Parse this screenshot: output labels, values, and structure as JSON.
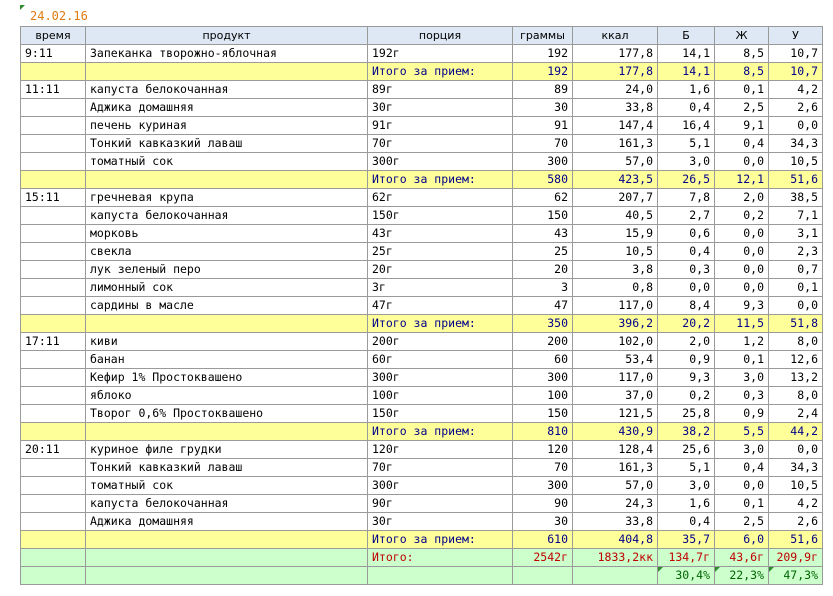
{
  "date": "24.02.16",
  "columns": [
    "время",
    "продукт",
    "порция",
    "граммы",
    "ккал",
    "Б",
    "Ж",
    "У"
  ],
  "meals": [
    {
      "time": "9:11",
      "items": [
        [
          "Запеканка творожно-яблочная",
          "192г",
          "192",
          "177,8",
          "14,1",
          "8,5",
          "10,7"
        ]
      ],
      "subtotal": [
        "Итого за прием:",
        "192",
        "177,8",
        "14,1",
        "8,5",
        "10,7"
      ]
    },
    {
      "time": "11:11",
      "items": [
        [
          "капуста белокочанная",
          "89г",
          "89",
          "24,0",
          "1,6",
          "0,1",
          "4,2"
        ],
        [
          "Аджика домашняя",
          "30г",
          "30",
          "33,8",
          "0,4",
          "2,5",
          "2,6"
        ],
        [
          "печень куриная",
          "91г",
          "91",
          "147,4",
          "16,4",
          "9,1",
          "0,0"
        ],
        [
          "Тонкий кавказкий лаваш",
          "70г",
          "70",
          "161,3",
          "5,1",
          "0,4",
          "34,3"
        ],
        [
          "томатный сок",
          "300г",
          "300",
          "57,0",
          "3,0",
          "0,0",
          "10,5"
        ]
      ],
      "subtotal": [
        "Итого за прием:",
        "580",
        "423,5",
        "26,5",
        "12,1",
        "51,6"
      ]
    },
    {
      "time": "15:11",
      "items": [
        [
          "гречневая крупа",
          "62г",
          "62",
          "207,7",
          "7,8",
          "2,0",
          "38,5"
        ],
        [
          "капуста белокочанная",
          "150г",
          "150",
          "40,5",
          "2,7",
          "0,2",
          "7,1"
        ],
        [
          "морковь",
          "43г",
          "43",
          "15,9",
          "0,6",
          "0,0",
          "3,1"
        ],
        [
          "свекла",
          "25г",
          "25",
          "10,5",
          "0,4",
          "0,0",
          "2,3"
        ],
        [
          "лук зеленый перо",
          "20г",
          "20",
          "3,8",
          "0,3",
          "0,0",
          "0,7"
        ],
        [
          "лимонный сок",
          "3г",
          "3",
          "0,8",
          "0,0",
          "0,0",
          "0,1"
        ],
        [
          "сардины в масле",
          "47г",
          "47",
          "117,0",
          "8,4",
          "9,3",
          "0,0"
        ]
      ],
      "subtotal": [
        "Итого за прием:",
        "350",
        "396,2",
        "20,2",
        "11,5",
        "51,8"
      ]
    },
    {
      "time": "17:11",
      "items": [
        [
          "киви",
          "200г",
          "200",
          "102,0",
          "2,0",
          "1,2",
          "8,0"
        ],
        [
          "банан",
          "60г",
          "60",
          "53,4",
          "0,9",
          "0,1",
          "12,6"
        ],
        [
          "Кефир 1% Простоквашено",
          "300г",
          "300",
          "117,0",
          "9,3",
          "3,0",
          "13,2"
        ],
        [
          "яблоко",
          "100г",
          "100",
          "37,0",
          "0,2",
          "0,3",
          "8,0"
        ],
        [
          "Творог 0,6% Простоквашено",
          "150г",
          "150",
          "121,5",
          "25,8",
          "0,9",
          "2,4"
        ]
      ],
      "subtotal": [
        "Итого за прием:",
        "810",
        "430,9",
        "38,2",
        "5,5",
        "44,2"
      ]
    },
    {
      "time": "20:11",
      "items": [
        [
          "куриное филе грудки",
          "120г",
          "120",
          "128,4",
          "25,6",
          "3,0",
          "0,0"
        ],
        [
          "Тонкий кавказкий лаваш",
          "70г",
          "70",
          "161,3",
          "5,1",
          "0,4",
          "34,3"
        ],
        [
          "томатный сок",
          "300г",
          "300",
          "57,0",
          "3,0",
          "0,0",
          "10,5"
        ],
        [
          "капуста белокочанная",
          "90г",
          "90",
          "24,3",
          "1,6",
          "0,1",
          "4,2"
        ],
        [
          "Аджика домашняя",
          "30г",
          "30",
          "33,8",
          "0,4",
          "2,5",
          "2,6"
        ]
      ],
      "subtotal": [
        "Итого за прием:",
        "610",
        "404,8",
        "35,7",
        "6,0",
        "51,6"
      ]
    }
  ],
  "total": [
    "Итого:",
    "2542г",
    "1833,2кк",
    "134,7г",
    "43,6г",
    "209,9г"
  ],
  "percent": [
    "30,4%",
    "22,3%",
    "47,3%"
  ],
  "colors": {
    "header_bg": "#dde8f4",
    "subtotal_bg": "#ffff99",
    "subtotal_text": "#00008b",
    "total_bg": "#ccffcc",
    "total_text": "#c00000",
    "percent_text": "#006400",
    "date_text": "#e07a10"
  }
}
